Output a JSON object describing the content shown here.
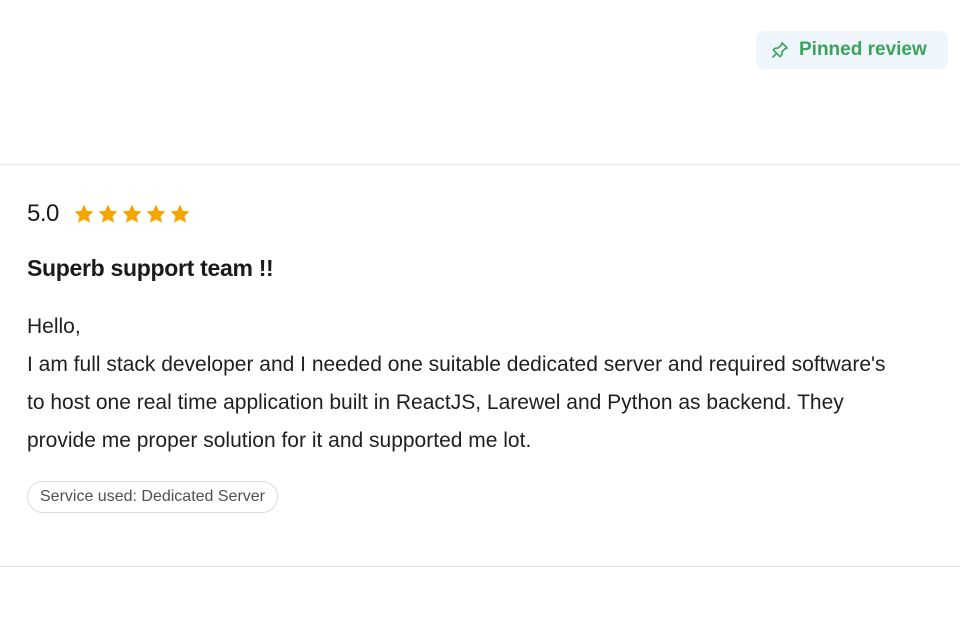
{
  "pinned": {
    "label": "Pinned review",
    "icon": "pin-icon",
    "color": "#3aa55a",
    "background": "#eef5fb"
  },
  "review": {
    "rating": "5.0",
    "stars": 5,
    "star_icon": "star-icon",
    "star_color": "#f5a500",
    "title": "Superb support team !!",
    "greeting": "Hello,",
    "body": "I am full stack developer and I needed one suitable dedicated server and required software's to host one real time application built in ReactJS, Larewel and Python as backend. They provide me proper solution for it and supported me lot.",
    "service_tag": "Service used: Dedicated Server"
  }
}
